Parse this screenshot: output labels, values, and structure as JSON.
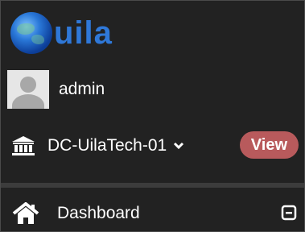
{
  "brand": {
    "name": "uila",
    "logo_icon": "globe-icon",
    "brand_color": "#2f78d8"
  },
  "user": {
    "name": "admin",
    "avatar_icon": "user-avatar-icon"
  },
  "datacenter": {
    "icon": "bank-icon",
    "name": "DC-UilaTech-01",
    "dropdown_icon": "chevron-down-icon",
    "view_label": "View",
    "view_color": "#b85a5c"
  },
  "nav": {
    "items": [
      {
        "label": "Dashboard",
        "icon": "home-icon",
        "toggle_icon": "collapse-icon"
      }
    ]
  },
  "colors": {
    "background": "#222222",
    "text": "#ffffff",
    "divider": "#3c3c3c"
  }
}
